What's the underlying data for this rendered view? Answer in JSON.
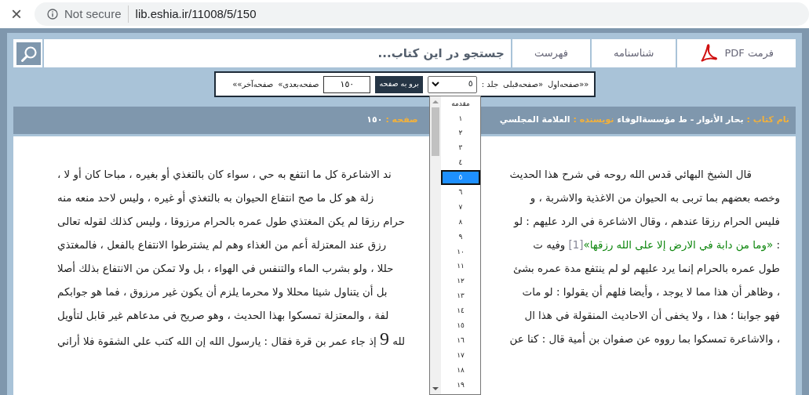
{
  "browser": {
    "close": "×",
    "security": "Not secure",
    "url": "lib.eshia.ir/11008/5/150"
  },
  "toolbar": {
    "pdf": "فرمت PDF",
    "items": [
      "شناسنامه",
      "فهرست"
    ],
    "search": {
      "placeholder": "جستجو در این کتاب..."
    }
  },
  "pager": {
    "first": "««صفحه‌اول",
    "prev": "«صفحه‌قبلی",
    "volume_label": "جلد :",
    "volume_value": "٥",
    "go_button": "برو به صفحه",
    "page_value": "١٥٠",
    "next": "صفحه‌بعدی»",
    "last": "صفحه‌آخر»»"
  },
  "info": [
    {
      "kind": "label",
      "text": "نام کتاب :"
    },
    {
      "kind": "value",
      "text": "بحار الأنوار - ط مؤسسةالوفاء"
    },
    {
      "kind": "label",
      "text": "نويسنده :"
    },
    {
      "kind": "value",
      "text": "العلامة المجلسي"
    },
    {
      "kind": "label",
      "text": "صفحه :"
    },
    {
      "kind": "value",
      "text": "١٥٠"
    }
  ],
  "volume_dropdown": {
    "options": [
      {
        "text": "مقدمه",
        "selected": false
      },
      {
        "text": "١",
        "selected": false
      },
      {
        "text": "٢",
        "selected": false
      },
      {
        "text": "٣",
        "selected": false
      },
      {
        "text": "٤",
        "selected": false
      },
      {
        "text": "٥",
        "selected": true
      },
      {
        "text": "٦",
        "selected": false
      },
      {
        "text": "٧",
        "selected": false
      },
      {
        "text": "٨",
        "selected": false
      },
      {
        "text": "٩",
        "selected": false
      },
      {
        "text": "١٠",
        "selected": false
      },
      {
        "text": "١١",
        "selected": false
      },
      {
        "text": "١٢",
        "selected": false
      },
      {
        "text": "١٣",
        "selected": false
      },
      {
        "text": "١٤",
        "selected": false
      },
      {
        "text": "١٥",
        "selected": false
      },
      {
        "text": "١٦",
        "selected": false
      },
      {
        "text": "١٧",
        "selected": false
      },
      {
        "text": "١٨",
        "selected": false
      },
      {
        "text": "١٩",
        "selected": false
      }
    ]
  },
  "lines": [
    {
      "right": [
        {
          "kind": "plain",
          "text": "قال الشيخ البهائي قدس الله روحه في شرح هذا الحديث"
        }
      ],
      "left": [
        {
          "kind": "plain",
          "text": "ند الاشاعرة كل ما انتفع به حي ، سواء كان بالتغذي أو بغيره ، مباحا كان أو لا ،"
        }
      ]
    },
    {
      "right": [
        {
          "kind": "plain",
          "text": "وخصه بعضهم بما تربى به الحيوان من الاغذية والاشربة ، و"
        }
      ],
      "left": [
        {
          "kind": "plain",
          "text": "زلة هو كل ما صح انتفاع الحيوان به بالتغذي أو غيره ، وليس لاحد منعه منه"
        }
      ]
    },
    {
      "right": [
        {
          "kind": "plain",
          "text": "فليس الحرام رزقا عندهم ، وقال الاشاعرة في الرد عليهم : لو"
        }
      ],
      "left": [
        {
          "kind": "plain",
          "text": "حرام رزقا لم يكن المغتذي طول عمره بالحرام مرزوقا ، وليس كذلك لقوله تعالى"
        }
      ]
    },
    {
      "right": [
        {
          "kind": "plain",
          "text": ": "
        },
        {
          "kind": "quote",
          "text": "«وما من دابة في الارض إلا على الله رزقها»"
        },
        {
          "kind": "footnote",
          "text": "[1]"
        },
        {
          "kind": "plain",
          "text": " وفيه ت"
        }
      ],
      "left": [
        {
          "kind": "plain",
          "text": "رزق عند المعتزلة أعم من الغذاء وهم لم يشترطوا الانتفاع بالفعل ، فالمغتذي"
        }
      ]
    },
    {
      "right": [
        {
          "kind": "plain",
          "text": "طول عمره بالحرام إنما يرد عليهم لو لم ينتفع مدة عمره بشئ"
        }
      ],
      "left": [
        {
          "kind": "plain",
          "text": "حللا ، ولو بشرب الماء والتنفس في الهواء ، بل ولا تمكن من الانتفاع بذلك أصلا"
        }
      ]
    },
    {
      "right": [
        {
          "kind": "plain",
          "text": "، وظاهر أن هذا مما لا يوجد ، وأيضا فلهم أن يقولوا : لو مات"
        }
      ],
      "left": [
        {
          "kind": "plain",
          "text": "بل أن يتناول شيئا محللا ولا محرما يلزم أن يكون غير مرزوق ، فما هو جوابكم"
        }
      ]
    },
    {
      "right": [
        {
          "kind": "plain",
          "text": "فهو جوابنا ؛ هذا ، ولا يخفى أن الاحاديث المنقولة في هذا ال"
        }
      ],
      "left": [
        {
          "kind": "plain",
          "text": "لفة ، والمعتزلة تمسكوا بهذا الحديث ، وهو صريح في مدعاهم غير قابل لتأويل"
        }
      ]
    },
    {
      "right": [
        {
          "kind": "plain",
          "text": "، والاشاعرة تمسكوا بما رووه عن صفوان بن أمية قال : كنا عن"
        }
      ],
      "left": [
        {
          "kind": "plain",
          "text": "لله "
        },
        {
          "kind": "symbol",
          "text": "9"
        },
        {
          "kind": "plain",
          "text": " إذ جاء عمر بن قرة فقال : يارسول الله إن الله كتب علي الشقوة فلا أراني"
        }
      ]
    }
  ]
}
